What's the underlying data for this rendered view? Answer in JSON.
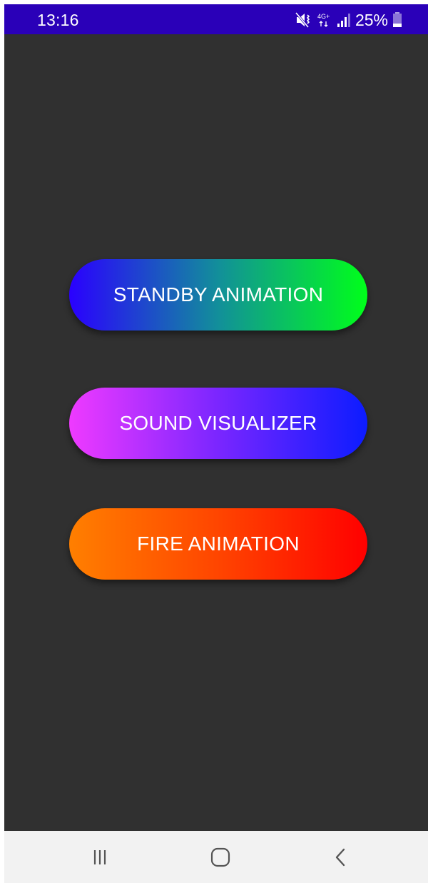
{
  "status_bar": {
    "time": "13:16",
    "battery": "25%",
    "icons": [
      "mute-icon",
      "network-4g-icon",
      "signal-icon",
      "battery-icon"
    ]
  },
  "buttons": {
    "standby": "STANDBY ANIMATION",
    "sound": "SOUND VISUALIZER",
    "fire": "FIRE ANIMATION"
  },
  "navigation": {
    "icons": [
      "recent-apps-icon",
      "home-icon",
      "back-icon"
    ]
  },
  "colors": {
    "status_bar": "#2a00b8",
    "background": "#303030",
    "standby_gradient": [
      "#2a00ff",
      "#00ff1a"
    ],
    "sound_gradient": [
      "#ef3aff",
      "#0c1cff"
    ],
    "fire_gradient": [
      "#ff7f00",
      "#ff0000"
    ],
    "nav_bar": "#f2f2f2"
  }
}
